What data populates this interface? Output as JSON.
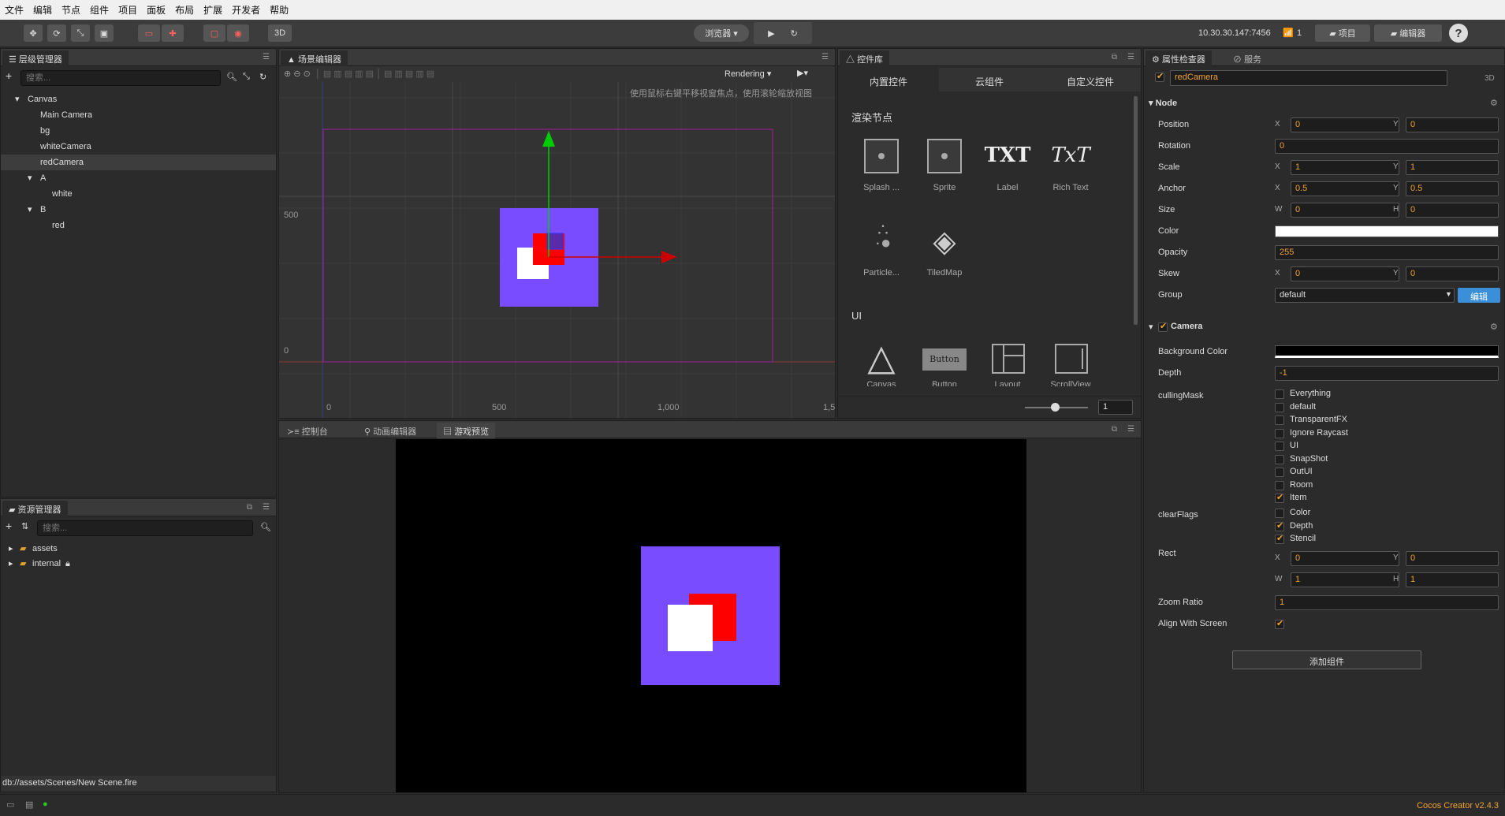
{
  "menubar": [
    "文件",
    "编辑",
    "节点",
    "组件",
    "项目",
    "面板",
    "布局",
    "扩展",
    "开发者",
    "帮助"
  ],
  "toolbar": {
    "mode_3d": "3D",
    "browser_label": "浏览器 ▾",
    "ip_address": "10.30.30.147:7456",
    "device_count": "1",
    "project_btn": "项目",
    "editor_btn": "编辑器"
  },
  "hierarchy": {
    "tab": "层级管理器",
    "search_placeholder": "搜索...",
    "items": [
      "Canvas",
      "Main Camera",
      "bg",
      "whiteCamera",
      "redCamera",
      "A",
      "white",
      "B",
      "red"
    ]
  },
  "assets": {
    "tab": "资源管理器",
    "search_placeholder": "搜索...",
    "items": [
      "assets",
      "internal"
    ],
    "status_path": "db://assets/Scenes/New Scene.fire"
  },
  "scene": {
    "tab": "场景编辑器",
    "rendering": "Rendering ▾",
    "hint": "使用鼠标右键平移视窗焦点，使用滚轮缩放视图",
    "ticks_y": [
      "500",
      "0"
    ],
    "ticks_x": [
      "0",
      "500",
      "1,000",
      "1,5"
    ]
  },
  "widgets": {
    "tab": "控件库",
    "tabs": [
      "内置控件",
      "云组件",
      "自定义控件"
    ],
    "section_render": "渲染节点",
    "section_ui": "UI",
    "render_items": [
      "Splash ...",
      "Sprite",
      "Label",
      "Rich Text",
      "Particle...",
      "TiledMap"
    ],
    "ui_items": [
      "Canvas",
      "Button",
      "Layout",
      "ScrollView"
    ],
    "button_text": "Button",
    "label_icon": "TXT",
    "richtext_icon": "TxT",
    "zoom_value": "1"
  },
  "bottom_tabs": [
    "控制台",
    "动画编辑器",
    "游戏预览"
  ],
  "inspector": {
    "tabs": [
      "属性检查器",
      "服务"
    ],
    "node_name": "redCamera",
    "node_3d": "3D",
    "node_section": "Node",
    "position": {
      "label": "Position",
      "x": "0",
      "y": "0"
    },
    "rotation": {
      "label": "Rotation",
      "v": "0"
    },
    "scale": {
      "label": "Scale",
      "x": "1",
      "y": "1"
    },
    "anchor": {
      "label": "Anchor",
      "x": "0.5",
      "y": "0.5"
    },
    "size": {
      "label": "Size",
      "w": "0",
      "h": "0"
    },
    "color_label": "Color",
    "opacity": {
      "label": "Opacity",
      "v": "255"
    },
    "skew": {
      "label": "Skew",
      "x": "0",
      "y": "0"
    },
    "group": {
      "label": "Group",
      "v": "default",
      "edit": "编辑"
    },
    "camera_section": "Camera",
    "bg_color_label": "Background Color",
    "depth": {
      "label": "Depth",
      "v": "-1"
    },
    "culling_label": "cullingMask",
    "culling": [
      {
        "name": "Everything",
        "on": false
      },
      {
        "name": "default",
        "on": false
      },
      {
        "name": "TransparentFX",
        "on": false
      },
      {
        "name": "Ignore Raycast",
        "on": false
      },
      {
        "name": "UI",
        "on": false
      },
      {
        "name": "SnapShot",
        "on": false
      },
      {
        "name": "OutUI",
        "on": false
      },
      {
        "name": "Room",
        "on": false
      },
      {
        "name": "Item",
        "on": true
      }
    ],
    "clear_label": "clearFlags",
    "clear": [
      {
        "name": "Color",
        "on": false
      },
      {
        "name": "Depth",
        "on": true
      },
      {
        "name": "Stencil",
        "on": true
      }
    ],
    "rect": {
      "label": "Rect",
      "x": "0",
      "y": "0",
      "w": "1",
      "h": "1"
    },
    "zoom": {
      "label": "Zoom Ratio",
      "v": "1"
    },
    "align_label": "Align With Screen",
    "add_component": "添加组件"
  },
  "status": {
    "version": "Cocos Creator v2.4.3"
  },
  "colors": {
    "accent": "#f0a030",
    "purple": "#7a4cff",
    "red": "#ff0000",
    "white": "#ffffff"
  }
}
